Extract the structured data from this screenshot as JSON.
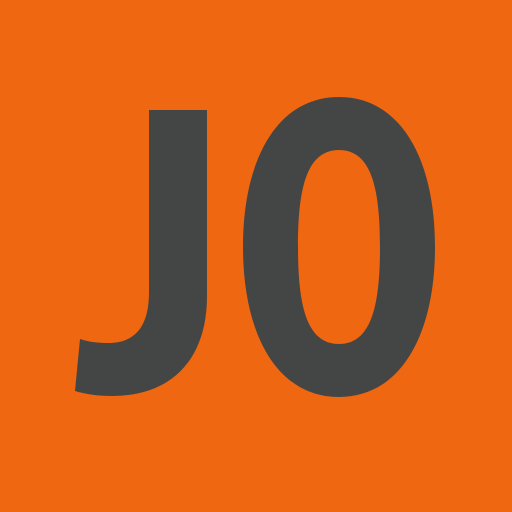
{
  "logo": {
    "text": "JO"
  },
  "colors": {
    "background": "#ef6711",
    "letters": "#444645"
  }
}
